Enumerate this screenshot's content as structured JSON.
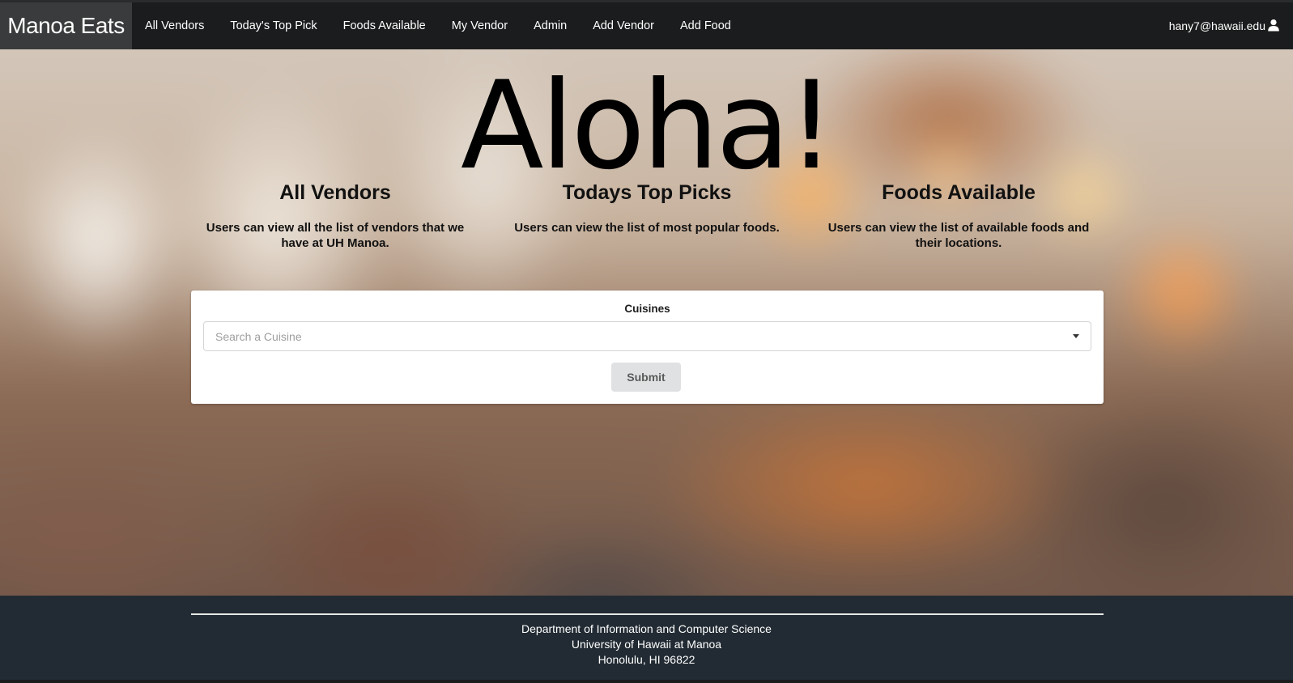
{
  "navbar": {
    "brand": "Manoa Eats",
    "items": [
      {
        "label": "All Vendors"
      },
      {
        "label": "Today's Top Pick"
      },
      {
        "label": "Foods Available"
      },
      {
        "label": "My Vendor"
      },
      {
        "label": "Admin"
      },
      {
        "label": "Add Vendor"
      },
      {
        "label": "Add Food"
      }
    ],
    "user": {
      "email": "hany7@hawaii.edu",
      "icon": "user-icon"
    }
  },
  "hero": {
    "title": "Aloha!",
    "features": [
      {
        "heading": "All Vendors",
        "text": "Users can view all the list of vendors that we have at UH Manoa."
      },
      {
        "heading": "Todays Top Picks",
        "text": "Users can view the list of most popular foods."
      },
      {
        "heading": "Foods Available",
        "text": "Users can view the list of available foods and their locations."
      }
    ]
  },
  "search": {
    "label": "Cuisines",
    "placeholder": "Search a Cuisine",
    "submit_label": "Submit",
    "icon": "chevron-down-icon"
  },
  "footer": {
    "lines": [
      "Department of Information and Computer Science",
      "University of Hawaii at Manoa",
      "Honolulu, HI 96822"
    ]
  },
  "colors": {
    "navbar_bg": "#1b1c1d",
    "brand_bg": "#3a3b3c",
    "footer_bg": "#222b33",
    "button_bg": "#e0e1e2"
  }
}
